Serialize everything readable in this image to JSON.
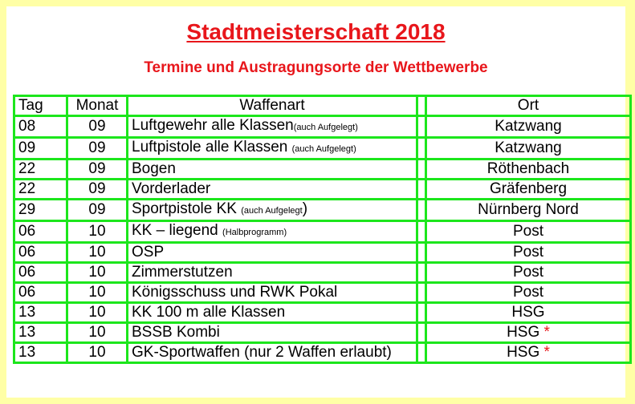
{
  "header": {
    "title": "Stadtmeisterschaft 2018",
    "subtitle": "Termine und Austragungsorte der Wettbewerbe"
  },
  "table": {
    "headers": {
      "tag": "Tag",
      "monat": "Monat",
      "waffenart": "Waffenart",
      "ort": "Ort"
    },
    "rows": [
      {
        "tag": "08",
        "monat": "09",
        "waffenart": "Luftgewehr alle Klassen",
        "note": "(auch Aufgelegt)",
        "ort": "Katzwang",
        "star": ""
      },
      {
        "tag": "09",
        "monat": "09",
        "waffenart": "Luftpistole alle Klassen ",
        "note": "(auch Aufgelegt)",
        "ort": "Katzwang",
        "star": ""
      },
      {
        "tag": "22",
        "monat": "09",
        "waffenart": "Bogen",
        "note": "",
        "ort": "Röthenbach",
        "star": ""
      },
      {
        "tag": "22",
        "monat": "09",
        "waffenart": "Vorderlader",
        "note": "",
        "ort": "Gräfenberg",
        "star": ""
      },
      {
        "tag": "29",
        "monat": "09",
        "waffenart": "Sportpistole KK ",
        "note": "(auch Aufgelegt",
        "suffix": ")",
        "ort": "Nürnberg Nord",
        "star": ""
      },
      {
        "tag": "06",
        "monat": "10",
        "waffenart": "KK – liegend ",
        "note": "(Halbprogramm)",
        "ort": "Post",
        "star": ""
      },
      {
        "tag": "06",
        "monat": "10",
        "waffenart": "OSP",
        "note": "",
        "ort": "Post",
        "star": ""
      },
      {
        "tag": "06",
        "monat": "10",
        "waffenart": "Zimmerstutzen",
        "note": "",
        "ort": "Post",
        "star": ""
      },
      {
        "tag": "06",
        "monat": "10",
        "waffenart": "Königsschuss und RWK Pokal",
        "note": "",
        "ort": "Post",
        "star": ""
      },
      {
        "tag": "13",
        "monat": "10",
        "waffenart": "KK 100 m alle Klassen",
        "note": "",
        "ort": "HSG",
        "star": ""
      },
      {
        "tag": "13",
        "monat": "10",
        "waffenart": "BSSB Kombi",
        "note": "",
        "ort": "HSG",
        "star": " *"
      },
      {
        "tag": "13",
        "monat": "10",
        "waffenart": "GK-Sportwaffen (nur 2 Waffen erlaubt)",
        "note": "",
        "ort": "HSG",
        "star": " *"
      }
    ]
  },
  "colors": {
    "page_bg": "#ffffa6",
    "accent": "#e8161b",
    "grid": "#1ce61c"
  }
}
